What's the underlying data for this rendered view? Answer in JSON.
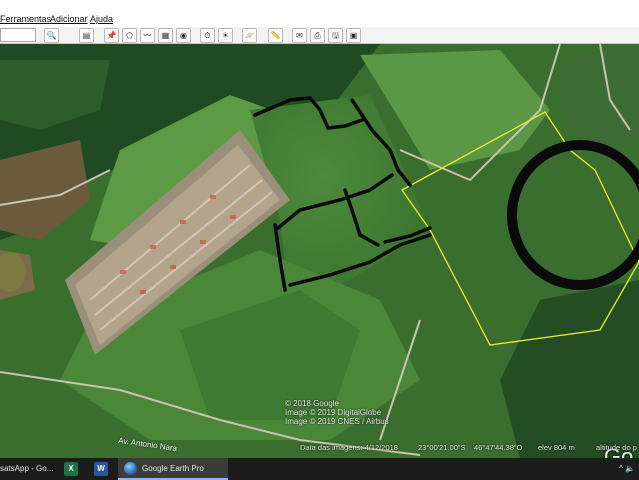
{
  "menu": {
    "items": [
      "Ferramentas",
      "Adicionar",
      "Ajuda"
    ]
  },
  "toolbar": {
    "buttons": [
      {
        "name": "search",
        "icon": "search-icon",
        "glyph": "🔍"
      },
      {
        "name": "sidebar",
        "icon": "sidebar-toggle-icon",
        "glyph": "▤"
      },
      {
        "name": "placemark",
        "icon": "placemark-icon",
        "glyph": "📌"
      },
      {
        "name": "polygon",
        "icon": "polygon-icon",
        "glyph": "⬠"
      },
      {
        "name": "path",
        "icon": "path-icon",
        "glyph": "〰"
      },
      {
        "name": "overlay",
        "icon": "image-overlay-icon",
        "glyph": "▦"
      },
      {
        "name": "tour",
        "icon": "record-tour-icon",
        "glyph": "◉"
      },
      {
        "name": "historical",
        "icon": "historical-imagery-icon",
        "glyph": "⏱"
      },
      {
        "name": "sun",
        "icon": "sunlight-icon",
        "glyph": "☀"
      },
      {
        "name": "planets",
        "icon": "planets-icon",
        "glyph": "🪐"
      },
      {
        "name": "ruler",
        "icon": "ruler-icon",
        "glyph": "📏"
      },
      {
        "name": "email",
        "icon": "email-icon",
        "glyph": "✉"
      },
      {
        "name": "print",
        "icon": "print-icon",
        "glyph": "⎙"
      },
      {
        "name": "save-image",
        "icon": "save-image-icon",
        "glyph": "🖫"
      },
      {
        "name": "maps",
        "icon": "google-maps-icon",
        "glyph": "▣"
      }
    ]
  },
  "map": {
    "attribution": [
      "© 2018 Google",
      "Image © 2019 DigitalGlobe",
      "Image © 2019 CNES / Airbus"
    ],
    "road_label": "Av. Antonio Nara",
    "logo": "Go",
    "status": {
      "imagery_date": "Data das imagens: 4/12/2018",
      "lat": "23°00'21.00\"S",
      "lon": "46°47'44.38\"O",
      "elev": "elev   804 m",
      "eye_alt": "altitude do p"
    },
    "colors": {
      "boundary": "#e7ec2c",
      "annotation": "#0a0a0a"
    }
  },
  "taskbar": {
    "apps": [
      {
        "label": "satsApp - Go...",
        "icon": "whatsapp-icon"
      },
      {
        "label": "",
        "icon": "excel-icon"
      },
      {
        "label": "",
        "icon": "word-icon"
      },
      {
        "label": "Google Earth Pro",
        "icon": "google-earth-icon"
      }
    ],
    "tray": "^ 🔈"
  }
}
